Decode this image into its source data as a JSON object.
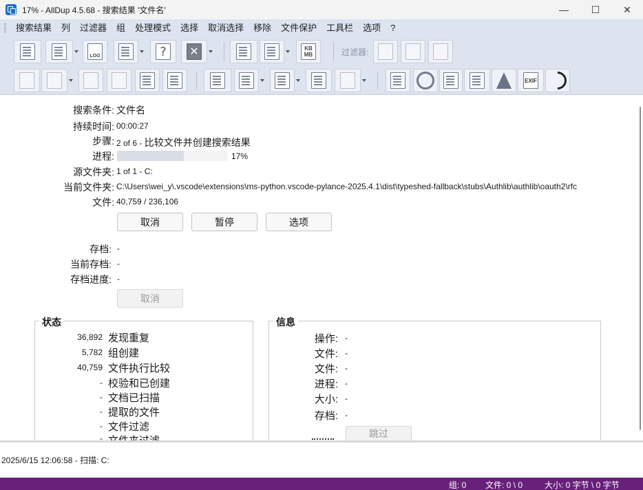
{
  "window": {
    "title": "17% - AllDup 4.5.68 - 搜索结果 '文件名'",
    "minimize": "—",
    "maximize": "☐",
    "close": "✕"
  },
  "menu": [
    "搜索结果",
    "列",
    "过滤器",
    "组",
    "处理模式",
    "选择",
    "取消选择",
    "移除",
    "文件保护",
    "工具栏",
    "选项",
    "?"
  ],
  "toolbar": {
    "filter_label": "过滤器:",
    "kb_label": "KB\nMB",
    "log_label": "LOG",
    "exif_label": "EXIF",
    "help_label": "?",
    "stop_label": "✕"
  },
  "progress": {
    "search_condition_label": "搜索条件",
    "search_condition_value": "文件名",
    "duration_label": "持续时间",
    "duration_value": "00:00:27",
    "step_label": "步骤",
    "step_count": "2 of 6",
    "step_desc": "比较文件并创建搜索结果",
    "progress_label": "进程",
    "progress_percent": 17,
    "progress_text": "17%",
    "source_folder_label": "源文件夹",
    "source_folder_value": "1 of 1 - C:",
    "current_folder_label": "当前文件夹",
    "current_folder_value": "C:\\Users\\wei_y\\.vscode\\extensions\\ms-python.vscode-pylance-2025.4.1\\dist\\typeshed-fallback\\stubs\\Authlib\\authlib\\oauth2\\rfc",
    "files_label": "文件",
    "files_value": "40,759 / 236,106",
    "cancel_button": "取消",
    "pause_button": "暂停",
    "options_button": "选项",
    "archive_label": "存档",
    "archive_value": "-",
    "current_archive_label": "当前存档",
    "current_archive_value": "-",
    "archive_progress_label": "存档进度",
    "archive_progress_value": "-",
    "archive_cancel_button": "取消"
  },
  "status_group": {
    "title": "状态",
    "items": [
      {
        "count": "36,892",
        "text": "发现重复"
      },
      {
        "count": "5,782",
        "text": "组创建"
      },
      {
        "count": "40,759",
        "text": "文件执行比较"
      },
      {
        "count": "-",
        "text": "校验和已创建"
      },
      {
        "count": "-",
        "text": "文档已扫描"
      },
      {
        "count": "-",
        "text": "提取的文件"
      },
      {
        "count": "-",
        "text": "文件过滤"
      },
      {
        "count": "-",
        "text": "文件夹过滤"
      }
    ]
  },
  "info_group": {
    "title": "信息",
    "items": [
      {
        "label": "操作",
        "value": "-"
      },
      {
        "label": "文件",
        "value": "-"
      },
      {
        "label": "文件",
        "value": "-"
      },
      {
        "label": "进程",
        "value": "-"
      },
      {
        "label": "大小",
        "value": "-"
      },
      {
        "label": "存档",
        "value": "-"
      }
    ],
    "skip_button": "跳过"
  },
  "log": {
    "line": "2025/6/15 12:06:58 - 扫描: C:"
  },
  "statusbar": {
    "group": "组: 0",
    "files": "文件: 0 \\ 0",
    "size": "大小: 0 字节 \\ 0 字节"
  }
}
